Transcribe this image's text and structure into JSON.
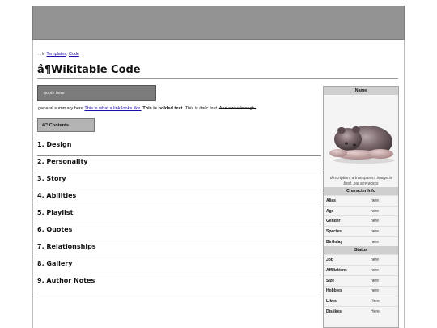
{
  "breadcrumb": {
    "prefix": "...In",
    "link1": "Templates",
    "sep": ",",
    "link2": "Code"
  },
  "page": {
    "title": "â¶Wikitable Code"
  },
  "quote": {
    "text": "quote here"
  },
  "summary": {
    "lead": "general summary here",
    "link": "This is what a link looks like.",
    "bold": "This is bolded text.",
    "italic": "This is italic text.",
    "strike": "And strikethrough."
  },
  "toc": {
    "label": "â˜° Contents"
  },
  "sections": [
    {
      "label": "1. Design"
    },
    {
      "label": "2. Personality"
    },
    {
      "label": "3. Story"
    },
    {
      "label": "4. Abilities"
    },
    {
      "label": "5. Playlist"
    },
    {
      "label": "6. Quotes"
    },
    {
      "label": "7. Relationships"
    },
    {
      "label": "8. Gallery"
    },
    {
      "label": "9. Author Notes"
    }
  ],
  "infobox": {
    "name_header": "Name",
    "image_icon": "lounging-creature-image",
    "caption": "description. a transparent image is best, but any works",
    "character_info_header": "Character Info",
    "character_info": [
      {
        "key": "Alias",
        "value": "here"
      },
      {
        "key": "Age",
        "value": "here"
      },
      {
        "key": "Gender",
        "value": "here"
      },
      {
        "key": "Species",
        "value": "here"
      },
      {
        "key": "Birthday",
        "value": "here"
      }
    ],
    "status_header": "Status",
    "status": [
      {
        "key": "Job",
        "value": "here"
      },
      {
        "key": "Affiliations",
        "value": "here"
      },
      {
        "key": "Size",
        "value": "here"
      },
      {
        "key": "Hobbies",
        "value": "here"
      },
      {
        "key": "Likes",
        "value": "Here"
      },
      {
        "key": "Dislikes",
        "value": "Here"
      }
    ]
  },
  "colors": {
    "header_band": "#939393",
    "quote_bg": "#7b7b7b",
    "toc_bg": "#b4b4b4",
    "infobox_head": "#cfcfcf",
    "link": "#1a0dab"
  }
}
